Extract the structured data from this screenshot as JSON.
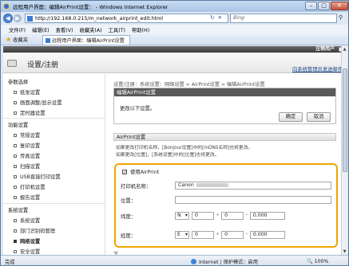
{
  "window": {
    "title": "远程用户界面：编辑AirPrint设置： - Windows Internet Explorer",
    "minimize": "–",
    "maximize": "□",
    "close": "✕"
  },
  "address": {
    "url": "http://192.168.0.215/m_network_airprint_edit.html",
    "refresh": "↻",
    "stop": "✕",
    "search_placeholder": "Bing",
    "search_icon": "magnifier-icon"
  },
  "menu": [
    "文件(F)",
    "编辑(E)",
    "查看(V)",
    "收藏夹(A)",
    "工具(T)",
    "帮助(H)"
  ],
  "favorites_label": "收藏夹",
  "tab_label": "远程用户界面：编辑AirPrint设置",
  "app": {
    "logout": "注销用户",
    "header_title": "设置/注册",
    "admin_link": "向系统管理员发送邮件"
  },
  "sidebar": {
    "sections": [
      {
        "title": "参数选择",
        "items": [
          "纸张设置",
          "画面调整/显示设置",
          "定时器设置"
        ]
      },
      {
        "title": "功能设置",
        "items": [
          "常规设置",
          "复印设置",
          "传真设置",
          "扫描设置",
          "USB直接打印设置",
          "打印机设置",
          "报告设置"
        ]
      },
      {
        "title": "系统设置",
        "items": [
          "系统设置",
          "部门识别码管理",
          "网络设置",
          "安全设置"
        ]
      }
    ],
    "active": "网络设置"
  },
  "main": {
    "breadcrumb": "设置/注册：系统设置：网络设置 > AirPrint设置 > 编辑AirPrint设置",
    "edit_box_title": "编辑AirPrint设置",
    "edit_box_message": "更改以下设置。",
    "ok": "确定",
    "cancel": "取消",
    "section_title": "AirPrint设置",
    "note1": "如果更改打印机名称，[Bonjour设置]中的[mDNS名称]也将更改。",
    "note2": "如果更改[位置]，[系统设置]中的[位置]也将更改。",
    "use_airprint": "使用AirPrint",
    "printer_name_label": "打印机名称：",
    "printer_name_value": "Canon",
    "location_label": "位置：",
    "latitude_label": "纬度：",
    "latitude": {
      "dir": "N",
      "deg": "0",
      "min": "0",
      "sec": "0.000"
    },
    "longitude_label": "经度：",
    "longitude": {
      "dir": "E",
      "deg": "0",
      "min": "0",
      "sec": "0.000"
    },
    "degree_symbol": "°",
    "minute_symbol": "'",
    "bottom_text": "下"
  },
  "status": {
    "left": "完成",
    "zone": "Internet | 保护模式：启用",
    "zoom": "🔍 100%"
  }
}
